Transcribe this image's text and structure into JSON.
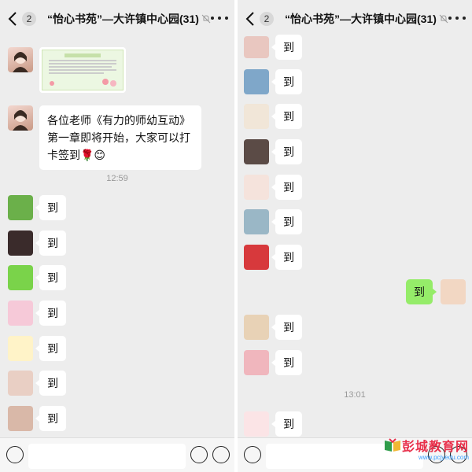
{
  "header": {
    "back_badge": "2",
    "title": "“怡心书苑”—大许镇中心园(31)"
  },
  "left_pane": {
    "announcement_text": "各位老师《有力的师幼互动》第一章即将开始，大家可以打卡签到🌹😊",
    "timestamp": "12:59",
    "checkins": [
      "到",
      "到",
      "到",
      "到",
      "到",
      "到",
      "到"
    ]
  },
  "right_pane": {
    "checkins_before_mine": [
      "到",
      "到",
      "到",
      "到",
      "到",
      "到",
      "到"
    ],
    "my_message": "到",
    "checkins_after_mine": [
      "到",
      "到"
    ],
    "timestamp": "13:01",
    "last_checkin": "到"
  },
  "watermark": {
    "title": "彭城教育网",
    "url": "www.pcjyedu.com"
  },
  "colors": {
    "background": "#ededed",
    "bubble_other": "#ffffff",
    "bubble_mine": "#95ec69",
    "watermark_red": "#e8304b"
  },
  "icons": {
    "back": "chevron-left-icon",
    "mute": "bell-off-icon",
    "more": "more-dots-icon",
    "voice": "voice-icon",
    "emoji": "emoji-icon",
    "plus": "plus-icon"
  }
}
